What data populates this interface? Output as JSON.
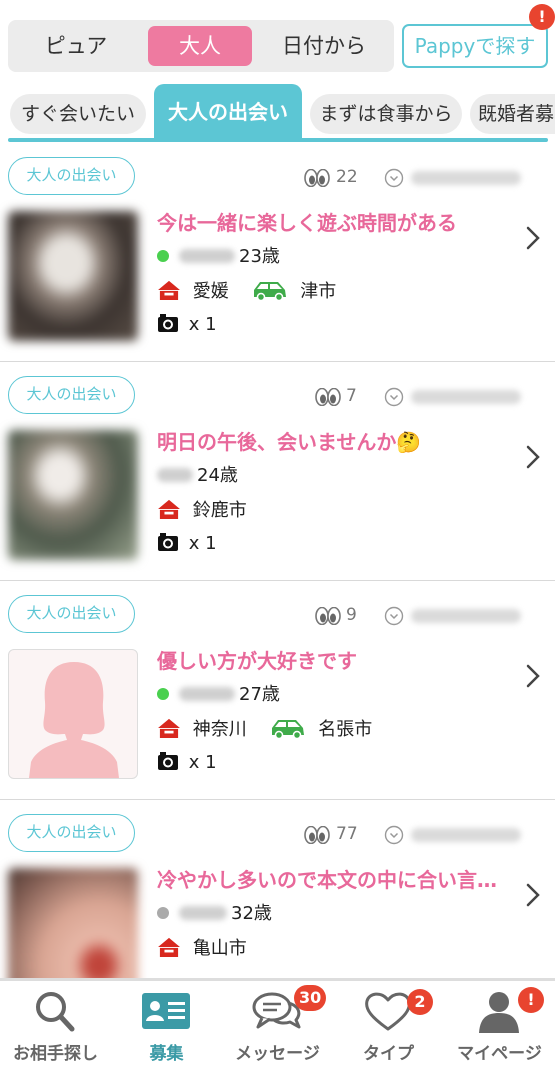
{
  "segments": [
    "ピュア",
    "大人",
    "日付から"
  ],
  "pappy_button": "Pappyで探す",
  "pappy_badge": "!",
  "tabs": [
    "すぐ会いたい",
    "大人の出会い",
    "まずは食事から",
    "既婚者募"
  ],
  "accent_color": "#5cc6d4",
  "pink_color": "#ee7aa0",
  "posts": [
    {
      "tag": "大人の出会い",
      "views": "22",
      "title": "今は一緒に楽しく遊ぶ時間がある",
      "online": "green",
      "age": "23歳",
      "home": "愛媛",
      "car_place": "津市",
      "photos": "x 1"
    },
    {
      "tag": "大人の出会い",
      "views": "7",
      "title": "明日の午後、会いませんか🤔",
      "online": "none",
      "age": "24歳",
      "home": "鈴鹿市",
      "car_place": "",
      "photos": "x 1"
    },
    {
      "tag": "大人の出会い",
      "views": "9",
      "title": "優しい方が大好きです",
      "online": "green",
      "age": "27歳",
      "home": "神奈川",
      "car_place": "名張市",
      "photos": "x 1"
    },
    {
      "tag": "大人の出会い",
      "views": "77",
      "title": "冷やかし多いので本文の中に合い言…",
      "online": "gray",
      "age": "32歳",
      "home": "亀山市",
      "car_place": "",
      "photos": "x 1"
    }
  ],
  "nav": [
    {
      "label": "お相手探し",
      "icon": "search-icon"
    },
    {
      "label": "募集",
      "icon": "profile-card-icon"
    },
    {
      "label": "メッセージ",
      "icon": "chat-bubbles-icon",
      "badge": "30"
    },
    {
      "label": "タイプ",
      "icon": "heart-icon",
      "badge": "2"
    },
    {
      "label": "マイページ",
      "icon": "user-icon",
      "badge": "!"
    }
  ]
}
